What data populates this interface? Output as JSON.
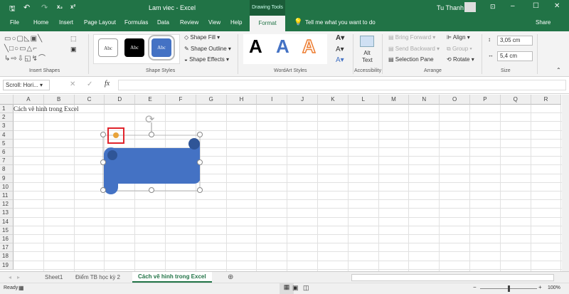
{
  "window": {
    "title": "Lam viec  -  Excel",
    "context_tab_group": "Drawing Tools",
    "user": "Tu Thanh"
  },
  "quick_access": {
    "save": "save-icon",
    "undo": "undo-icon",
    "redo": "redo-icon",
    "subscript": "x₂",
    "superscript": "x²"
  },
  "tabs": [
    "File",
    "Home",
    "Insert",
    "Page Layout",
    "Formulas",
    "Data",
    "Review",
    "View",
    "Help",
    "Format"
  ],
  "active_tab": "Format",
  "tell_me": "Tell me what you want to do",
  "share": "Share",
  "ribbon": {
    "insert_shapes": {
      "label": "Insert Shapes"
    },
    "shape_styles": {
      "label": "Shape Styles",
      "presets": [
        "Abc",
        "Abc",
        "Abc"
      ],
      "fill": "Shape Fill",
      "outline": "Shape Outline",
      "effects": "Shape Effects"
    },
    "wordart": {
      "label": "WordArt Styles",
      "presets": [
        "A",
        "A",
        "A"
      ]
    },
    "accessibility": {
      "label": "Accessibility",
      "alt_text": "Alt Text"
    },
    "arrange": {
      "label": "Arrange",
      "bring_forward": "Bring Forward",
      "send_backward": "Send Backward",
      "selection_pane": "Selection Pane",
      "align": "Align",
      "group": "Group",
      "rotate": "Rotate"
    },
    "size": {
      "label": "Size",
      "height": "3,05 cm",
      "width": "5,4 cm"
    }
  },
  "formula_bar": {
    "name_box": "Scroll: Hori...",
    "fx": "fx",
    "value": ""
  },
  "columns": [
    "A",
    "B",
    "C",
    "D",
    "E",
    "F",
    "G",
    "H",
    "I",
    "J",
    "K",
    "L",
    "M",
    "N",
    "O",
    "P",
    "Q",
    "R"
  ],
  "rows": [
    "1",
    "2",
    "3",
    "4",
    "5",
    "6",
    "7",
    "8",
    "9",
    "10",
    "11",
    "12",
    "13",
    "14",
    "15",
    "16",
    "17",
    "18",
    "19"
  ],
  "cells": {
    "A1": "Cách vẽ hình trong Excel"
  },
  "shape": {
    "type": "horizontal-scroll",
    "fill": "#4472c4"
  },
  "sheets": [
    "Sheet1",
    "Điểm TB học kỳ 2",
    "Cách vẽ hình trong Excel"
  ],
  "active_sheet": "Cách vẽ hình trong Excel",
  "status": {
    "text": "Ready",
    "zoom": "100%"
  },
  "colors": {
    "brand": "#217346",
    "accent_red": "#e0242c"
  }
}
